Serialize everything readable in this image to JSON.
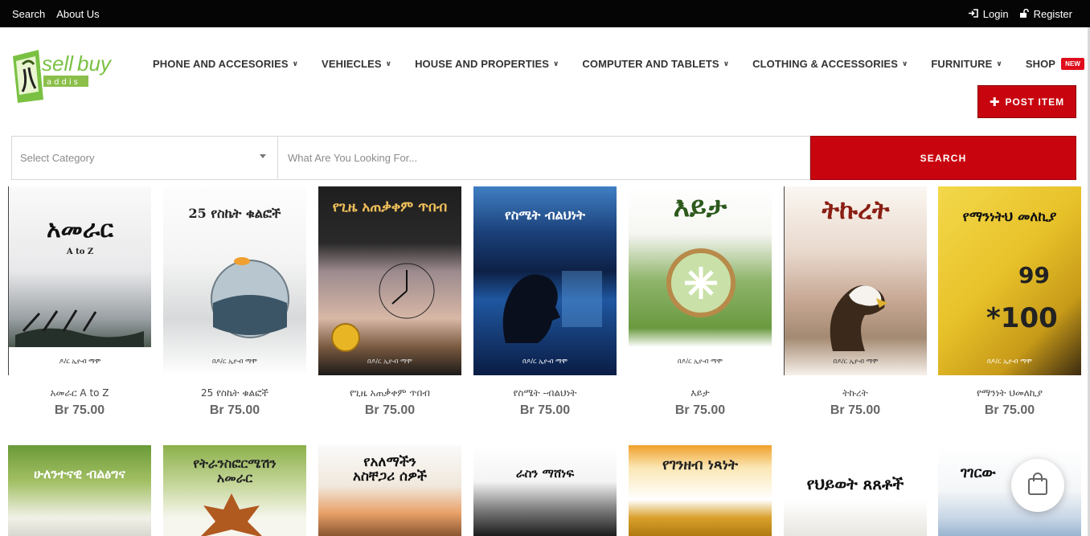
{
  "topbar": {
    "search_link": "Search",
    "about_link": "About Us",
    "login_link": "Login",
    "register_link": "Register"
  },
  "nav": {
    "items": [
      {
        "label": "PHONE AND ACCESORIES"
      },
      {
        "label": "VEHIECLES"
      },
      {
        "label": "HOUSE AND PROPERTIES"
      },
      {
        "label": "COMPUTER AND TABLETS"
      },
      {
        "label": "CLOTHING & ACCESSORIES"
      },
      {
        "label": "FURNITURE"
      }
    ],
    "shop_label": "SHOP",
    "shop_badge": "NEW"
  },
  "post_item_label": "POST ITEM",
  "search": {
    "category_placeholder": "Select Category",
    "query_placeholder": "What Are You Looking For...",
    "button_label": "SEARCH"
  },
  "colors": {
    "brand_red": "#c8040f",
    "topbar": "#050505"
  },
  "products_row1": [
    {
      "cover_title": "አመራር",
      "cover_sub": "A to Z",
      "cover_author": "ዶ/ር ኢዮብ ማሞ",
      "title": "አመራር A to Z",
      "price": "Br 75.00"
    },
    {
      "cover_title": "25 የስኬት ቁልፎች",
      "cover_sub": "",
      "cover_author": "በዶ/ር ኢዮብ ማሞ",
      "title": "25 የስኬት ቁልፎች",
      "price": "Br 75.00"
    },
    {
      "cover_title": "የጊዜ አጠቃቀም ጥበብ",
      "cover_sub": "",
      "cover_author": "በዶ/ር ኢዮብ ማሞ",
      "title": "የጊዜ አጠቃቀም ጥበብ",
      "price": "Br 75.00"
    },
    {
      "cover_title": "የስሜት ብልህነት",
      "cover_sub": "",
      "cover_author": "በዶ/ር ኢዮብ ማሞ",
      "title": "የስሜት -ብልህነት",
      "price": "Br 75.00"
    },
    {
      "cover_title": "እይታ",
      "cover_sub": "",
      "cover_author": "በዶ/ር ኢዮብ ማሞ",
      "title": "እይታ",
      "price": "Br 75.00"
    },
    {
      "cover_title": "ትኩረት",
      "cover_sub": "",
      "cover_author": "በዶ/ር ኢዮብ ማሞ",
      "title": "ትኩረት",
      "price": "Br 75.00"
    },
    {
      "cover_title": "የማንነትህ መለኪያ",
      "cover_sub": "",
      "cover_author": "በዶ/ር ኢዮብ ማሞ",
      "title": "የማንነት ህመለኪያ",
      "price": "Br 75.00"
    }
  ],
  "products_row2": [
    {
      "cover_title": "ሁለንተናዊ ብልፅግና"
    },
    {
      "cover_title": "የትራንስፎርሜሽን አመራር"
    },
    {
      "cover_title": "የአለማችን አስቸጋሪ ሰዎች"
    },
    {
      "cover_title": "ራስን ማሸነፍ"
    },
    {
      "cover_title": "የገንዘብ ነጻነት"
    },
    {
      "cover_title": "የህይወት ጸጸቶች"
    },
    {
      "cover_title": "ገገርው"
    }
  ]
}
